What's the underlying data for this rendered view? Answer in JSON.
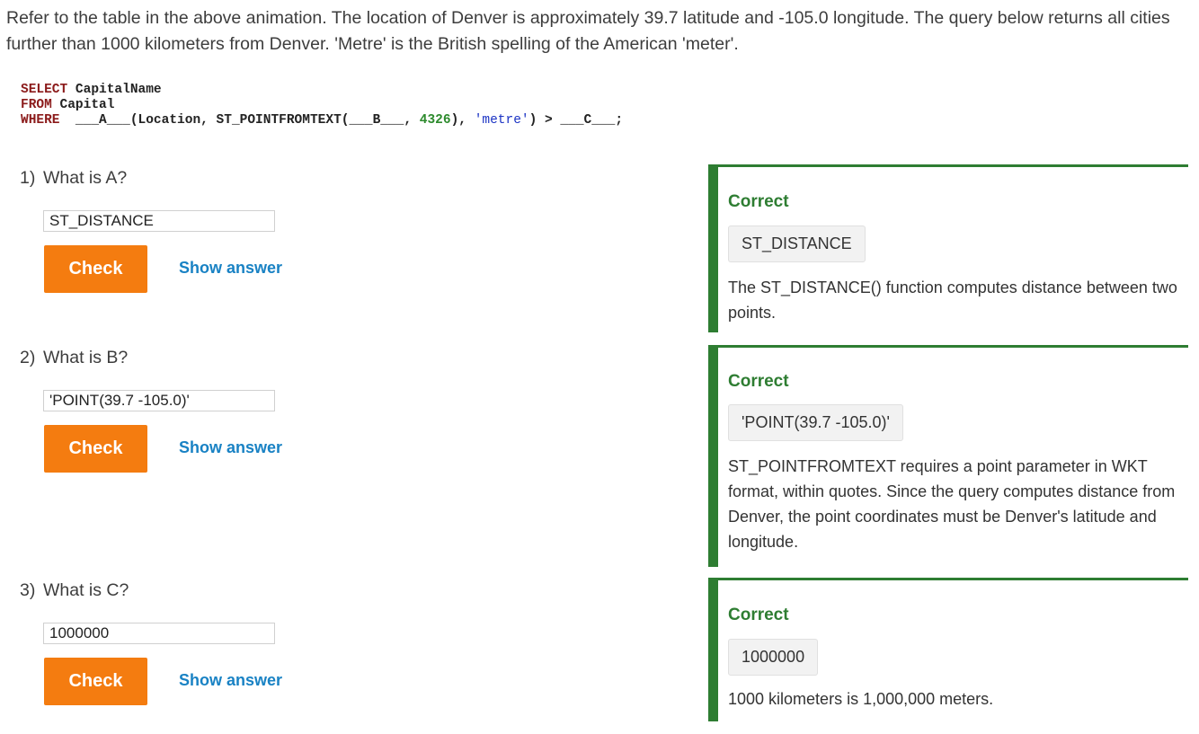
{
  "intro": "Refer to the table in the above animation. The location of Denver is approximately 39.7 latitude and -105.0 longitude. The query below returns all cities further than 1000 kilometers from Denver. 'Metre' is the British spelling of the American 'meter'.",
  "code": {
    "line1_kw": "SELECT",
    "line1_rest": " CapitalName",
    "line2_kw": "FROM",
    "line2_rest": " Capital",
    "line3_kw": "WHERE",
    "line3_a": "  ___A___(Location, ST_POINTFROMTEXT(___B___, ",
    "line3_num": "4326",
    "line3_b": "), ",
    "line3_str": "'metre'",
    "line3_c": ") > ___C___;"
  },
  "questions": [
    {
      "number": "1)",
      "label": "What is A?",
      "input_value": "ST_DISTANCE",
      "check_label": "Check",
      "show_answer_label": "Show answer",
      "feedback": {
        "status": "Correct",
        "answer": "ST_DISTANCE",
        "explanation": "The ST_DISTANCE() function computes distance between two points."
      }
    },
    {
      "number": "2)",
      "label": "What is B?",
      "input_value": "'POINT(39.7 -105.0)'",
      "check_label": "Check",
      "show_answer_label": "Show answer",
      "feedback": {
        "status": "Correct",
        "answer": "'POINT(39.7 -105.0)'",
        "explanation": "ST_POINTFROMTEXT requires a point parameter in WKT format, within quotes. Since the query computes distance from Denver, the point coordinates must be Denver's latitude and longitude."
      }
    },
    {
      "number": "3)",
      "label": "What is C?",
      "input_value": "1000000",
      "check_label": "Check",
      "show_answer_label": "Show answer",
      "feedback": {
        "status": "Correct",
        "answer": "1000000",
        "explanation": "1000 kilometers is 1,000,000 meters."
      }
    }
  ],
  "colors": {
    "check_button": "#f47c10",
    "link": "#1982c4",
    "correct": "#2e7d32"
  }
}
